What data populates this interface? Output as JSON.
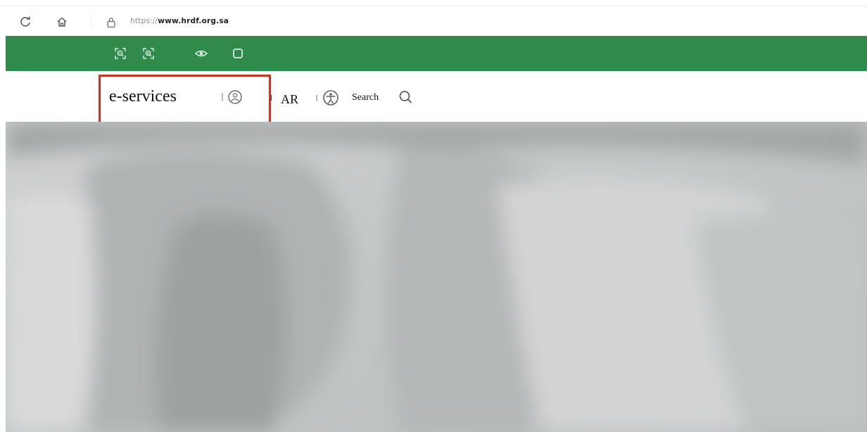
{
  "browser": {
    "url_scheme": "https://",
    "url_host": "www.hrdf.org.sa",
    "icons": {
      "reload": "reload-icon",
      "home": "home-icon",
      "lock": "lock-icon"
    }
  },
  "accessibility_bar": {
    "background_color": "#2f8a4c",
    "tools": [
      "zoom-out-icon",
      "zoom-in-icon",
      "eye-icon",
      "contrast-icon"
    ]
  },
  "header": {
    "eservices_label": "e-services",
    "language_label": "AR",
    "search_label": "Search",
    "icons": {
      "user": "user-icon",
      "accessibility": "accessibility-icon",
      "search": "search-icon"
    },
    "highlight_color": "#c0392b"
  },
  "hero": {
    "image": "blurred-grey-fabric-photo"
  }
}
